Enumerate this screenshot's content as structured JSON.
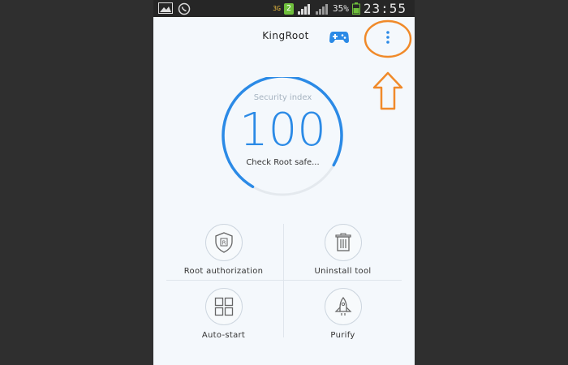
{
  "status_bar": {
    "network_type": "3G",
    "notification_badge": "2",
    "battery": "35%",
    "time": "23:55",
    "icons": [
      "gallery-icon",
      "whatsapp-icon",
      "signal-icon",
      "battery-icon"
    ]
  },
  "header": {
    "title": "KingRoot",
    "game_icon": "gamepad-icon",
    "menu_icon": "more-vertical-icon"
  },
  "security": {
    "label": "Security index",
    "score": "100",
    "status": "Check Root safe...",
    "progress": 0.75,
    "ring_color": "#2b8ae6"
  },
  "tools": [
    {
      "label": "Root authorization",
      "icon": "shield-r-icon"
    },
    {
      "label": "Uninstall tool",
      "icon": "trash-icon"
    },
    {
      "label": "Auto-start",
      "icon": "grid-icon"
    },
    {
      "label": "Purify",
      "icon": "rocket-icon"
    }
  ],
  "annotation": {
    "color": "#f08a2a",
    "shapes": [
      "highlight-ellipse",
      "arrow-up"
    ]
  }
}
